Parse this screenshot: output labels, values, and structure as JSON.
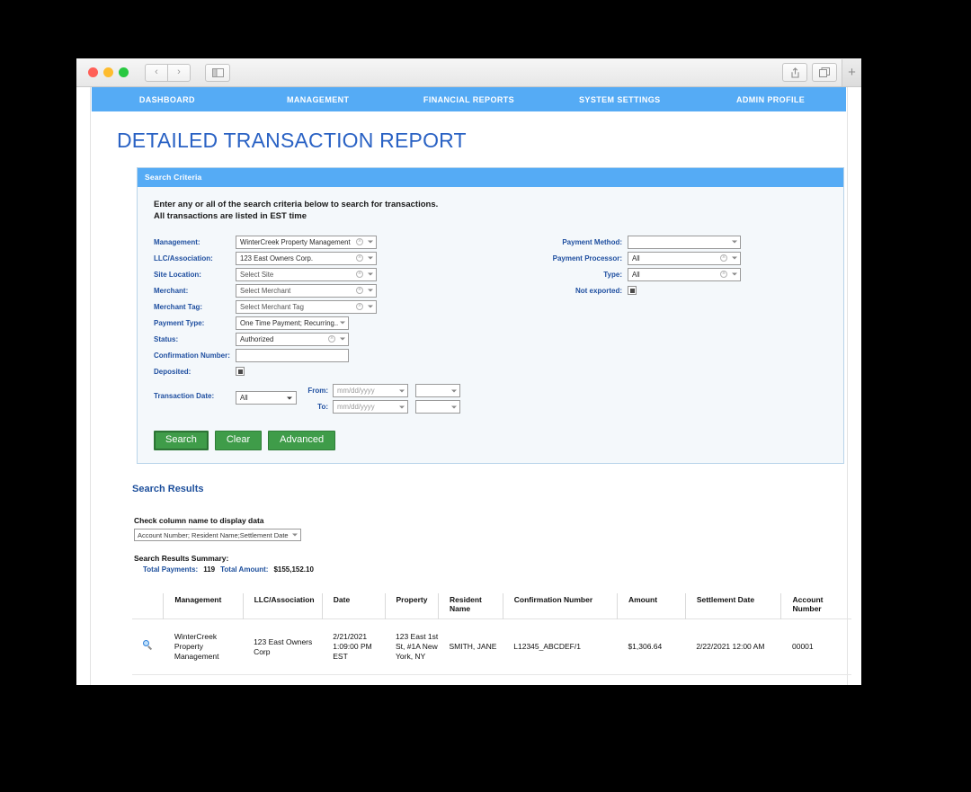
{
  "browser": {
    "back_icon": "chevron-left-icon",
    "forward_icon": "chevron-right-icon",
    "sidebar_icon": "sidebar-toggle-icon",
    "share_icon": "share-icon",
    "tabs_icon": "show-tabs-icon",
    "new_tab_label": "+"
  },
  "nav": {
    "items": [
      {
        "label": "DASHBOARD"
      },
      {
        "label": "MANAGEMENT"
      },
      {
        "label": "FINANCIAL REPORTS"
      },
      {
        "label": "SYSTEM SETTINGS"
      },
      {
        "label": "ADMIN PROFILE"
      }
    ]
  },
  "page": {
    "title": "DETAILED TRANSACTION REPORT",
    "accent_blue": "#2a62c4",
    "nav_blue": "#55abf5",
    "button_green": "#3f9c49"
  },
  "search_panel": {
    "header": "Search Criteria",
    "intro_line1": "Enter any or all of the search criteria below to search for transactions.",
    "intro_line2": "All transactions are listed in EST time",
    "left_fields": [
      {
        "label": "Management:",
        "value": "WinterCreek Property Management"
      },
      {
        "label": "LLC/Association:",
        "value": "123 East Owners Corp."
      },
      {
        "label": "Site Location:",
        "value": "Select Site"
      },
      {
        "label": "Merchant:",
        "value": "Select Merchant"
      },
      {
        "label": "Merchant Tag:",
        "value": "Select Merchant Tag"
      }
    ],
    "payment_type": {
      "label": "Payment Type:",
      "value": "One Time Payment; Recurring.."
    },
    "status": {
      "label": "Status:",
      "value": "Authorized"
    },
    "confirmation_number": {
      "label": "Confirmation Number:",
      "value": ""
    },
    "deposited": {
      "label": "Deposited:",
      "checked": true
    },
    "right_fields": [
      {
        "label": "Payment Method:",
        "value": ""
      },
      {
        "label": "Payment Processor:",
        "value": "All"
      },
      {
        "label": "Type:",
        "value": "All"
      }
    ],
    "not_exported": {
      "label": "Not exported:",
      "checked": true
    },
    "transaction_date": {
      "label": "Transaction Date:",
      "range_value": "All",
      "from_label": "From:",
      "from_placeholder": "mm/dd/yyyy",
      "to_label": "To:",
      "to_placeholder": "mm/dd/yyyy",
      "from_time": "",
      "to_time": ""
    },
    "buttons": {
      "search": "Search",
      "clear": "Clear",
      "advanced": "Advanced"
    }
  },
  "results": {
    "title": "Search Results",
    "column_picker_label": "Check column name to display data",
    "column_picker_value": "Account Number; Resident Name;Settlement Date",
    "summary_title": "Search Results Summary:",
    "total_payments_label": "Total Payments:",
    "total_payments_value": "119",
    "total_amount_label": "Total Amount:",
    "total_amount_value": "$155,152.10",
    "columns": [
      "Management",
      "LLC/Association",
      "Date",
      "Property",
      "Resident Name",
      "Confirmation Number",
      "Amount",
      "Settlement Date",
      "Account Number"
    ],
    "rows": [
      {
        "view_icon": "magnifier-icon",
        "management": "WinterCreek Property Management",
        "llc_association": "123 East Owners Corp",
        "date": "2/21/2021 1:09:00 PM EST",
        "property": "123 East 1st St, #1A New York, NY",
        "resident_name": "SMITH, JANE",
        "confirmation_number": "L12345_ABCDEF/1",
        "amount": "$1,306.64",
        "settlement_date": "2/22/2021 12:00 AM",
        "account_number": "00001"
      }
    ],
    "loading_indicator": "..."
  }
}
